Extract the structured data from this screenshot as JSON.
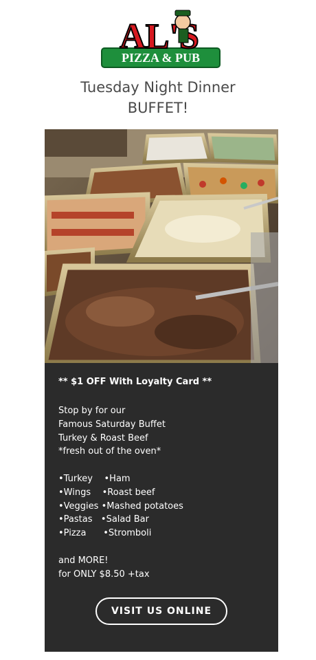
{
  "logo": {
    "name": "AL'S",
    "tagline": "PIZZA & PUB"
  },
  "headline": {
    "line1": "Tuesday Night Dinner",
    "line2": "BUFFET!"
  },
  "panel": {
    "promo": "** $1 OFF With Loyalty Card **",
    "intro": [
      "Stop by for our",
      "Famous Saturday Buffet",
      "Turkey & Roast Beef",
      "*fresh out of the oven*"
    ],
    "menu": [
      "•Turkey    •Ham",
      "•Wings    •Roast beef",
      "•Veggies •Mashed potatoes",
      "•Pastas   •Salad Bar",
      "•Pizza      •Stromboli"
    ],
    "outro": [
      "and MORE!",
      "for ONLY $8.50 +tax"
    ],
    "cta": "VISIT US ONLINE"
  },
  "colors": {
    "logo_red": "#d71920",
    "logo_green": "#1e8f3c",
    "panel_bg": "#2b2b2b",
    "headline": "#4a4a4a"
  }
}
